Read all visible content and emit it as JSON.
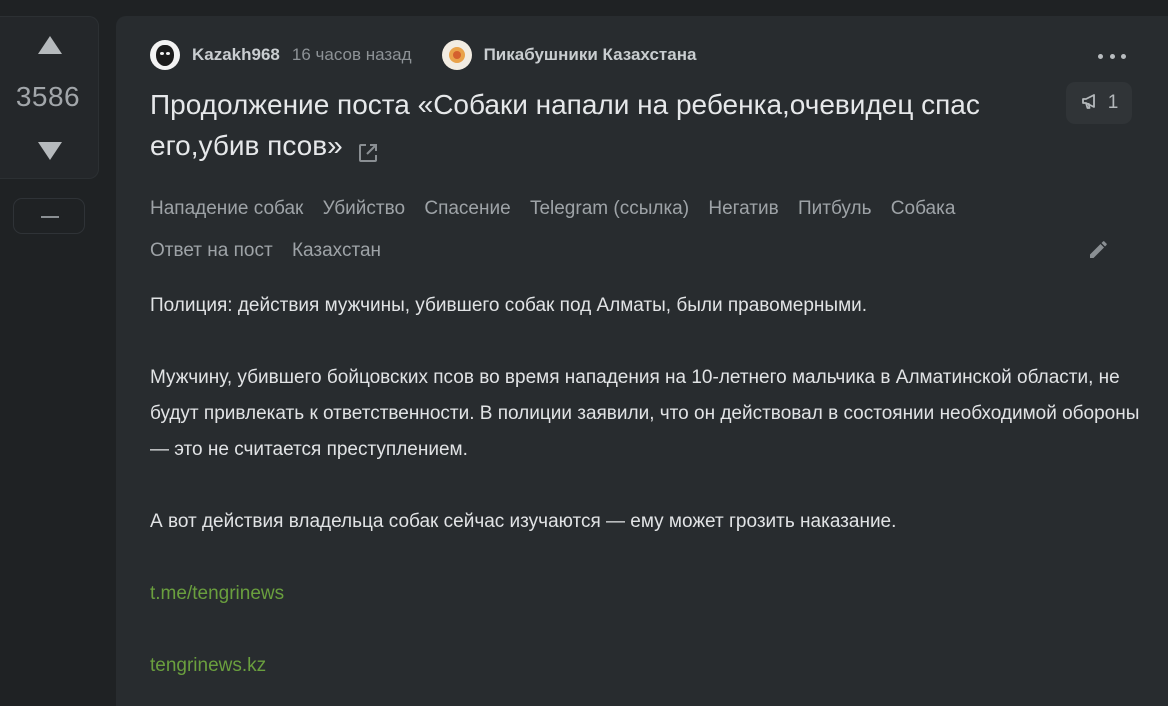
{
  "vote": {
    "count": "3586"
  },
  "post": {
    "author": "Kazakh968",
    "time": "16 часов назад",
    "community": "Пикабушники Казахстана",
    "title": "Продолжение поста «Собаки напали на ребенка,очевидец спас его,убив псов»",
    "comments_count": "1",
    "tags": [
      "Нападение собак",
      "Убийство",
      "Спасение",
      "Telegram (ссылка)",
      "Негатив",
      "Питбуль",
      "Собака",
      "Ответ на пост",
      "Казахстан"
    ],
    "paragraphs": [
      "Полиция: действия мужчины, убившего собак под Алматы, были правомерными.",
      "Мужчину, убившего бойцовских псов во время нападения на 10-летнего мальчика в Алматинской области, не будут привлекать к ответственности. В полиции заявили, что он действовал в состоянии необходимой обороны — это не считается преступлением.",
      "А вот действия владельца собак сейчас изучаются — ему может грозить наказание."
    ],
    "links": [
      "t.me/tengrinews",
      "tengrinews.kz"
    ]
  },
  "icons": {
    "vote_up": "triangle-up-icon",
    "vote_down": "triangle-down-icon",
    "collapse": "minus-icon",
    "more": "more-dots-icon",
    "external_link": "external-link-icon",
    "comments": "megaphone-icon",
    "edit": "pencil-icon"
  },
  "colors": {
    "background": "#1f2224",
    "card": "#282c2f",
    "link": "#6a9f3e",
    "tag": "#9ea3a7"
  }
}
